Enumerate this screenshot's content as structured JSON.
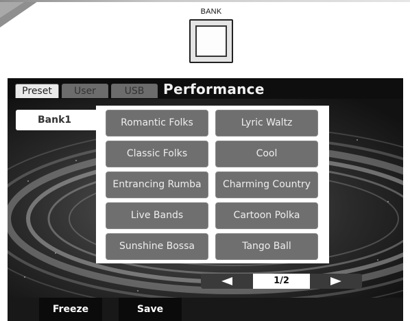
{
  "header": {
    "bank_caption": "BANK"
  },
  "screen": {
    "tabs": [
      {
        "label": "Preset",
        "active": true
      },
      {
        "label": "User",
        "active": false
      },
      {
        "label": "USB",
        "active": false
      }
    ],
    "title": "Performance",
    "bank_label": "Bank1",
    "styles": [
      "Romantic Folks",
      "Lyric Waltz",
      "Classic Folks",
      "Cool",
      "Entrancing Rumba",
      "Charming Country",
      "Live Bands",
      "Cartoon Polka",
      "Sunshine Bossa",
      "Tango Ball"
    ],
    "page_indicator": "1/2",
    "softkeys": {
      "freeze": "Freeze",
      "save": "Save"
    }
  },
  "icons": {
    "prev": "left-arrow-icon",
    "next": "right-arrow-icon"
  },
  "colors": {
    "button_gray": "#6f6f6f",
    "title_text": "#f2f2f2"
  }
}
